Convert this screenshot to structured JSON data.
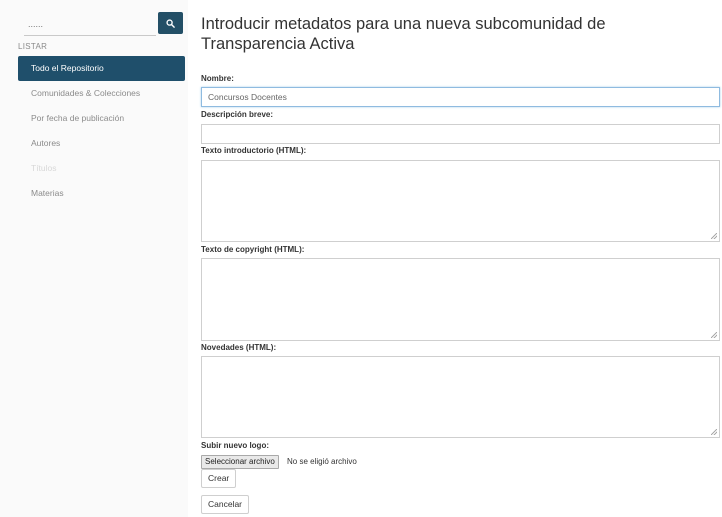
{
  "sidebar": {
    "search": {
      "value": "",
      "placeholder": "......"
    },
    "section_label": "LISTAR",
    "items": [
      {
        "label": "Todo el Repositorio",
        "active": true
      },
      {
        "label": "Comunidades & Colecciones"
      },
      {
        "label": "Por fecha de publicación"
      },
      {
        "label": "Autores"
      },
      {
        "label": "Títulos",
        "faded": true
      },
      {
        "label": "Materias"
      }
    ]
  },
  "page": {
    "title_line1": "Introducir metadatos para una nueva subcomunidad de",
    "title_line2": "Transparencia Activa"
  },
  "form": {
    "name_label": "Nombre:",
    "name_value": "Concursos Docentes",
    "short_desc_label": "Descripción breve:",
    "short_desc_value": "",
    "intro_label": "Texto introductorio (HTML):",
    "copyright_label": "Texto de copyright (HTML):",
    "news_label": "Novedades (HTML):",
    "logo_label": "Subir nuevo logo:",
    "file_button": "Seleccionar archivo",
    "file_status": "No se eligió archivo",
    "create_button": "Crear",
    "cancel_button": "Cancelar"
  },
  "colors": {
    "accent": "#1f4f6b",
    "search_button": "#234f66",
    "focus_border": "#8fbbe0"
  }
}
